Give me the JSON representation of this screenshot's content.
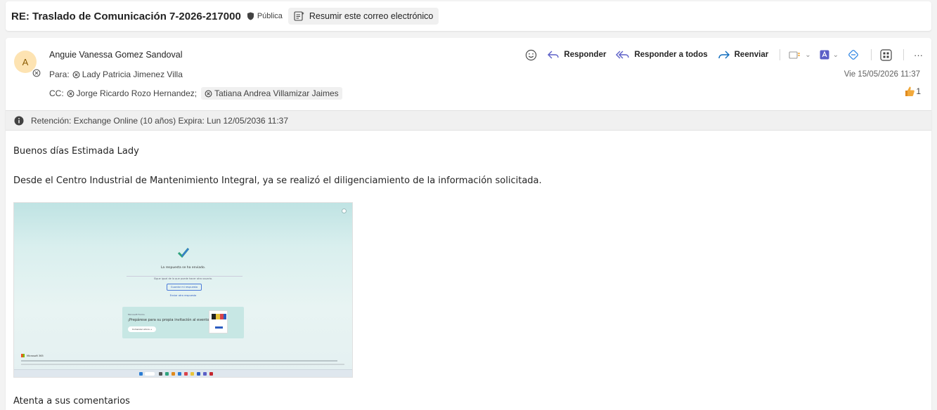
{
  "subject": {
    "title": "RE: Traslado de Comunicación 7-2026-217000",
    "sensitivity": "Pública",
    "summarize_label": "Resumir este correo electrónico"
  },
  "message": {
    "avatar_initial": "A",
    "sender": "Anguie Vanessa Gomez Sandoval",
    "to_label": "Para:",
    "to": [
      "Lady Patricia Jimenez Villa"
    ],
    "cc_label": "CC:",
    "cc": [
      "Jorge Ricardo Rozo Hernandez;",
      "Tatiana Andrea Villamizar Jaimes"
    ],
    "date": "Vie 15/05/2026 11:37",
    "reaction_count": "1"
  },
  "actions": {
    "reply": "Responder",
    "reply_all": "Responder a todos",
    "forward": "Reenviar",
    "more": "···"
  },
  "retention": {
    "text": "Retención: Exchange Online (10 años) Expira: Lun 12/05/2036 11:37"
  },
  "body": {
    "greeting": "Buenos días Estimada Lady",
    "paragraph": "Desde el Centro Industrial de Mantenimiento Integral, ya se realizó el diligenciamiento de la información solicitada.",
    "closing": "Atenta a sus comentarios"
  },
  "screenshot": {
    "title": "La respuesta se ha enviado.",
    "subtitle": "Sigue igual de lo que puede hacer otro usuario.",
    "button": "Guardar mi respuesta",
    "link": "Enviar otra respuesta",
    "card_small": "Microsoft Forms",
    "card_title": "¡Prepárese para su propia invitación al evento!",
    "card_button": "Comenzar ahora →",
    "brand": "Microsoft 365",
    "search": "Buscar"
  },
  "colors": {
    "accent": "#5b5fc7",
    "forward_blue": "#0f6cbd",
    "avatar_bg": "#fde3b2",
    "reaction": "#f2a93b"
  }
}
